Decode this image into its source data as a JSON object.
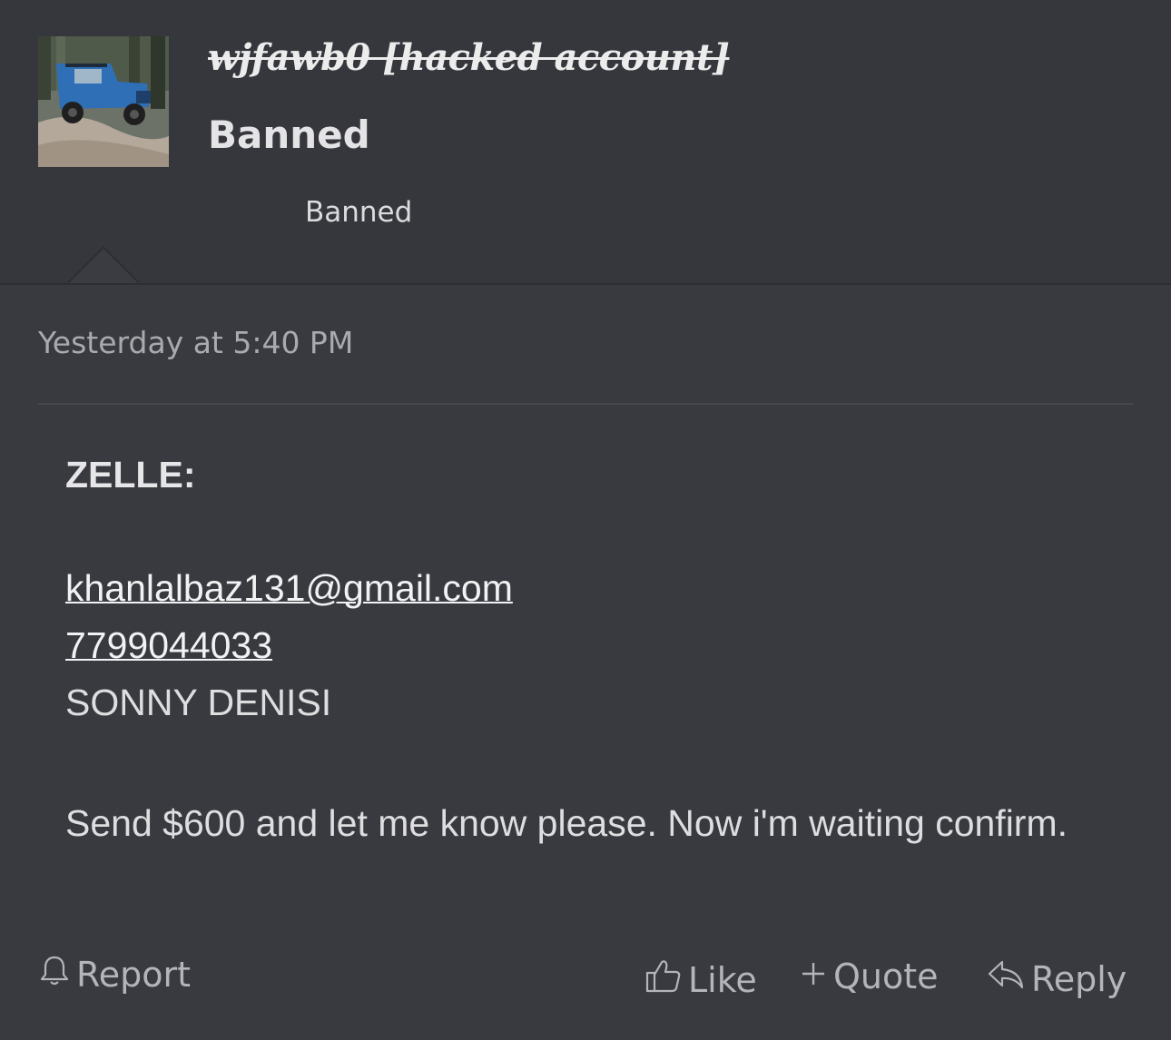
{
  "user": {
    "name": "wjfawb0 [hacked account]",
    "title": "Banned",
    "banner": "Banned"
  },
  "post": {
    "date": "Yesterday at 5:40 PM",
    "lines": {
      "heading": "ZELLE:",
      "email": "khanlalbaz131@gmail.com",
      "phone": "7799044033",
      "name": "SONNY DENISI",
      "message": "Send $600 and let me know please. Now i'm waiting confirm."
    }
  },
  "actions": {
    "report": "Report",
    "like": "Like",
    "quote": "Quote",
    "reply": "Reply"
  },
  "icons": {
    "report": "bell-icon",
    "like": "thumbs-up-icon",
    "quote": "plus-icon",
    "reply": "reply-arrow-icon"
  }
}
